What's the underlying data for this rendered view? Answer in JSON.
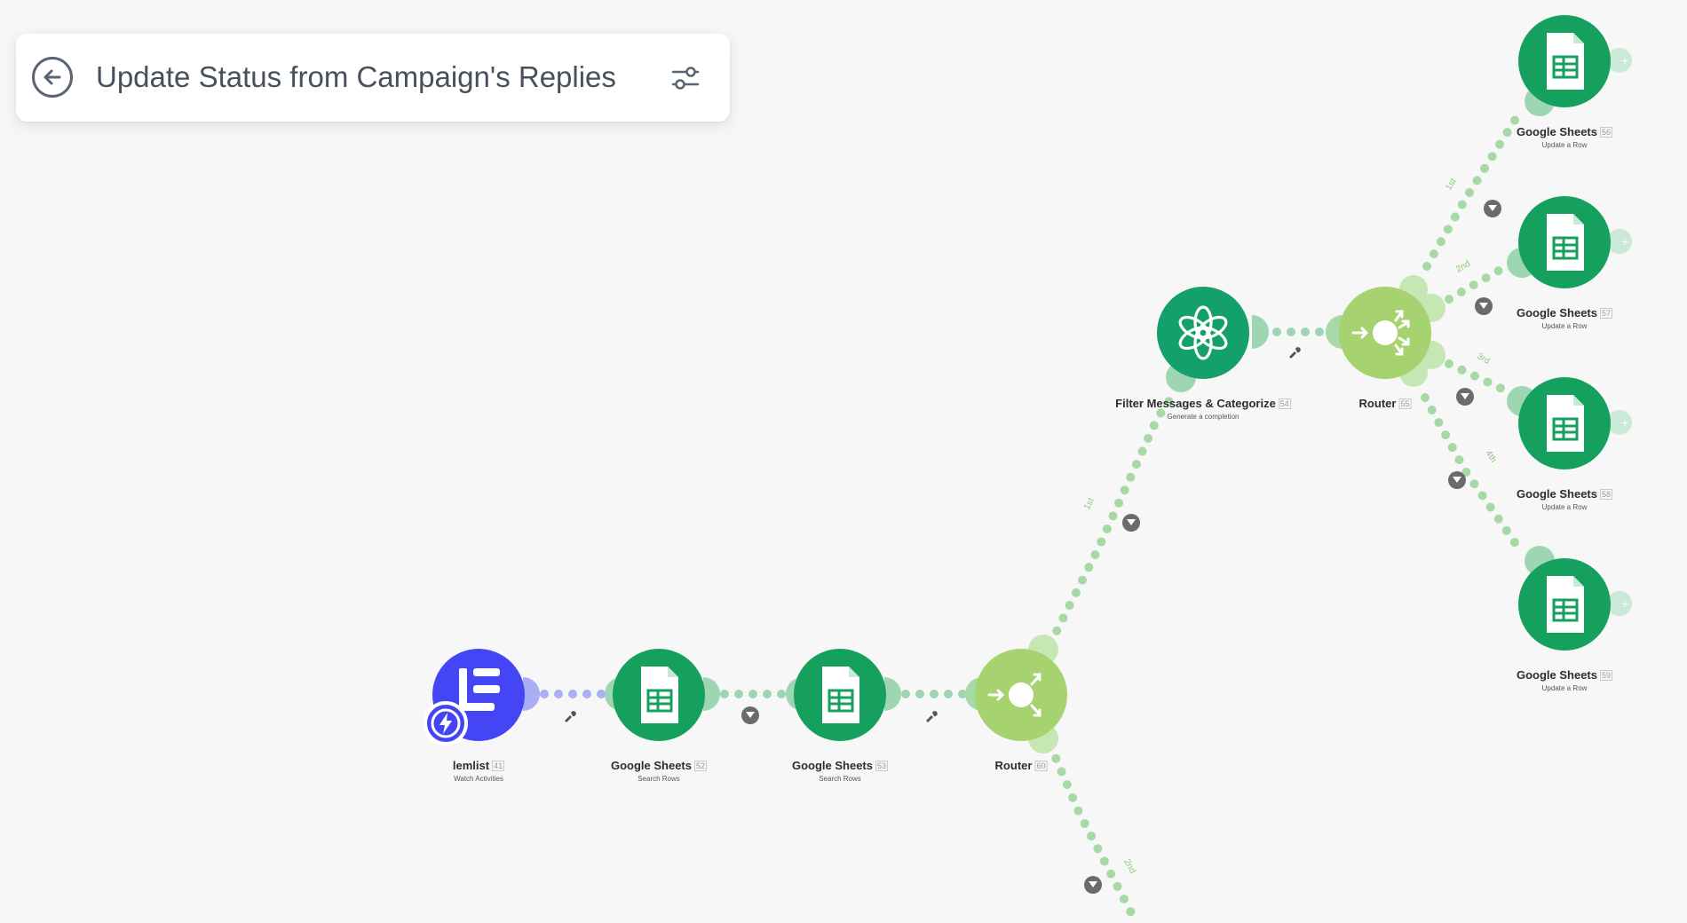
{
  "header": {
    "title": "Update Status from Campaign's Replies",
    "back_icon": "arrow-left-circle-icon",
    "settings_icon": "sliders-icon"
  },
  "colors": {
    "background": "#f7f7f7",
    "sheets_green": "#16a05e",
    "router_green": "#a6d270",
    "lemlist_blue": "#4446f6",
    "openai_green": "#14a06b"
  },
  "modules": [
    {
      "id": "lemlist",
      "name": "lemlist",
      "number": "41",
      "subtitle": "Watch Activities"
    },
    {
      "id": "sheets52",
      "name": "Google Sheets",
      "number": "52",
      "subtitle": "Search Rows"
    },
    {
      "id": "sheets53",
      "name": "Google Sheets",
      "number": "53",
      "subtitle": "Search Rows"
    },
    {
      "id": "router60",
      "name": "Router",
      "number": "60",
      "subtitle": ""
    },
    {
      "id": "openai54",
      "name": "Filter Messages & Categorize",
      "number": "54",
      "subtitle": "Generate a completion"
    },
    {
      "id": "router55",
      "name": "Router",
      "number": "55",
      "subtitle": ""
    },
    {
      "id": "sheets56",
      "name": "Google Sheets",
      "number": "56",
      "subtitle": "Update a Row"
    },
    {
      "id": "sheets57",
      "name": "Google Sheets",
      "number": "57",
      "subtitle": "Update a Row"
    },
    {
      "id": "sheets58",
      "name": "Google Sheets",
      "number": "58",
      "subtitle": "Update a Row"
    },
    {
      "id": "sheets59",
      "name": "Google Sheets",
      "number": "59",
      "subtitle": "Update a Row"
    }
  ],
  "route_labels": {
    "router60_1": "1st",
    "router60_2": "2nd",
    "router55_1": "1st",
    "router55_2": "2nd",
    "router55_3": "3rd",
    "router55_4": "4th"
  }
}
